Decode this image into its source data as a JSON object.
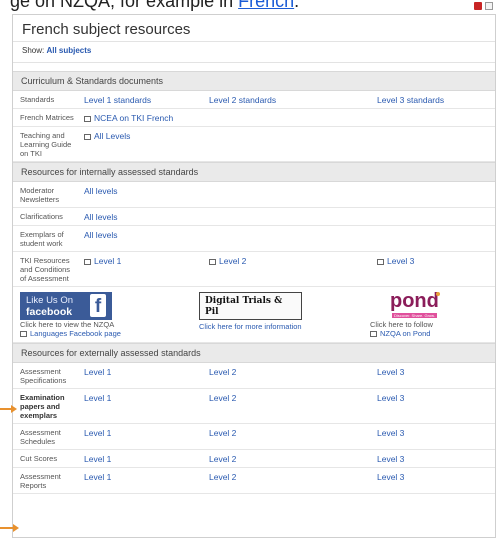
{
  "top_fragment": {
    "text": "ge on NZQA, for example in",
    "link": "French"
  },
  "panel": {
    "title": "French subject resources",
    "show_label": "Show:",
    "show_value": "All subjects"
  },
  "curriculum": {
    "heading": "Curriculum & Standards documents",
    "rows": [
      {
        "label": "Standards",
        "c1": "Level 1 standards",
        "c2": "Level 2 standards",
        "c3": "Level 3 standards"
      },
      {
        "label": "French Matrices",
        "c1": "NCEA on TKI French"
      },
      {
        "label": "Teaching and Learning Guide on TKI",
        "c1": "All Levels"
      }
    ]
  },
  "internal": {
    "heading": "Resources for internally assessed standards",
    "rows": [
      {
        "label": "Moderator Newsletters",
        "c1": "All levels"
      },
      {
        "label": "Clarifications",
        "c1": "All levels"
      },
      {
        "label": "Exemplars of student work",
        "c1": "All levels"
      },
      {
        "label": "TKI Resources and Conditions of Assessment",
        "c1": "Level 1",
        "c2": "Level 2",
        "c3": "Level 3"
      }
    ]
  },
  "promo": {
    "fb_line1": "Like Us On",
    "fb_line2": "facebook",
    "fb_letter": "f",
    "fb_text": "Click here to view the NZQA",
    "fb_link": "Languages Facebook page",
    "dt_title": "Digital Trials & Pil",
    "dt_link": "Click here for more information",
    "pond_logo": "pond",
    "pond_sub": "Discover. Share. Grow.",
    "pond_text": "Click here to follow",
    "pond_link": "NZQA on Pond"
  },
  "external": {
    "heading": "Resources for externally assessed standards",
    "rows": [
      {
        "label": "Assessment Specifications",
        "c1": "Level 1",
        "c2": "Level 2",
        "c3": "Level 3"
      },
      {
        "label": "Examination papers and exemplars",
        "c1": "Level 1",
        "c2": "Level 2",
        "c3": "Level 3"
      },
      {
        "label": "Assessment Schedules",
        "c1": "Level 1",
        "c2": "Level 2",
        "c3": "Level 3"
      },
      {
        "label": "Cut Scores",
        "c1": "Level 1",
        "c2": "Level 2",
        "c3": "Level 3"
      },
      {
        "label": "Assessment Reports",
        "c1": "Level 1",
        "c2": "Level 2",
        "c3": "Level 3"
      }
    ]
  },
  "colors": {
    "link": "#2a5ab0",
    "arrow": "#e8912e",
    "facebook": "#3b5b98"
  }
}
